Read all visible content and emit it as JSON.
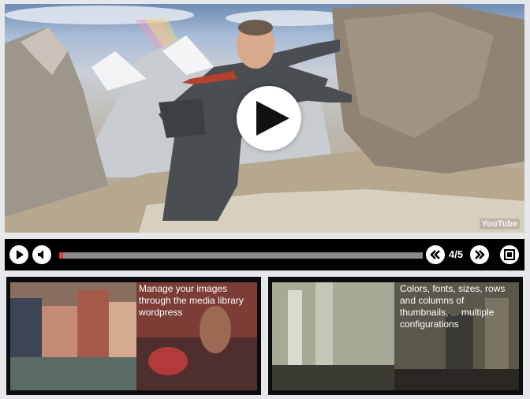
{
  "player": {
    "watermark": "YouTube",
    "counter": "4/5",
    "progress_fraction": 0.01
  },
  "icons": {
    "play": "play-icon",
    "volume": "speaker-icon",
    "prev": "rewind-icon",
    "next": "fast-forward-icon",
    "fullscreen": "fullscreen-icon"
  },
  "thumbnails": [
    {
      "caption": "Manage your images through the media library wordpress"
    },
    {
      "caption": "Colors, fonts, sizes, rows and columns of thumbnails, ... multiple configurations"
    }
  ],
  "colors": {
    "background": "#e6e7ea",
    "controlbar": "#000000",
    "progress_track": "#8a8a8a",
    "progress_fill": "#e04040"
  }
}
